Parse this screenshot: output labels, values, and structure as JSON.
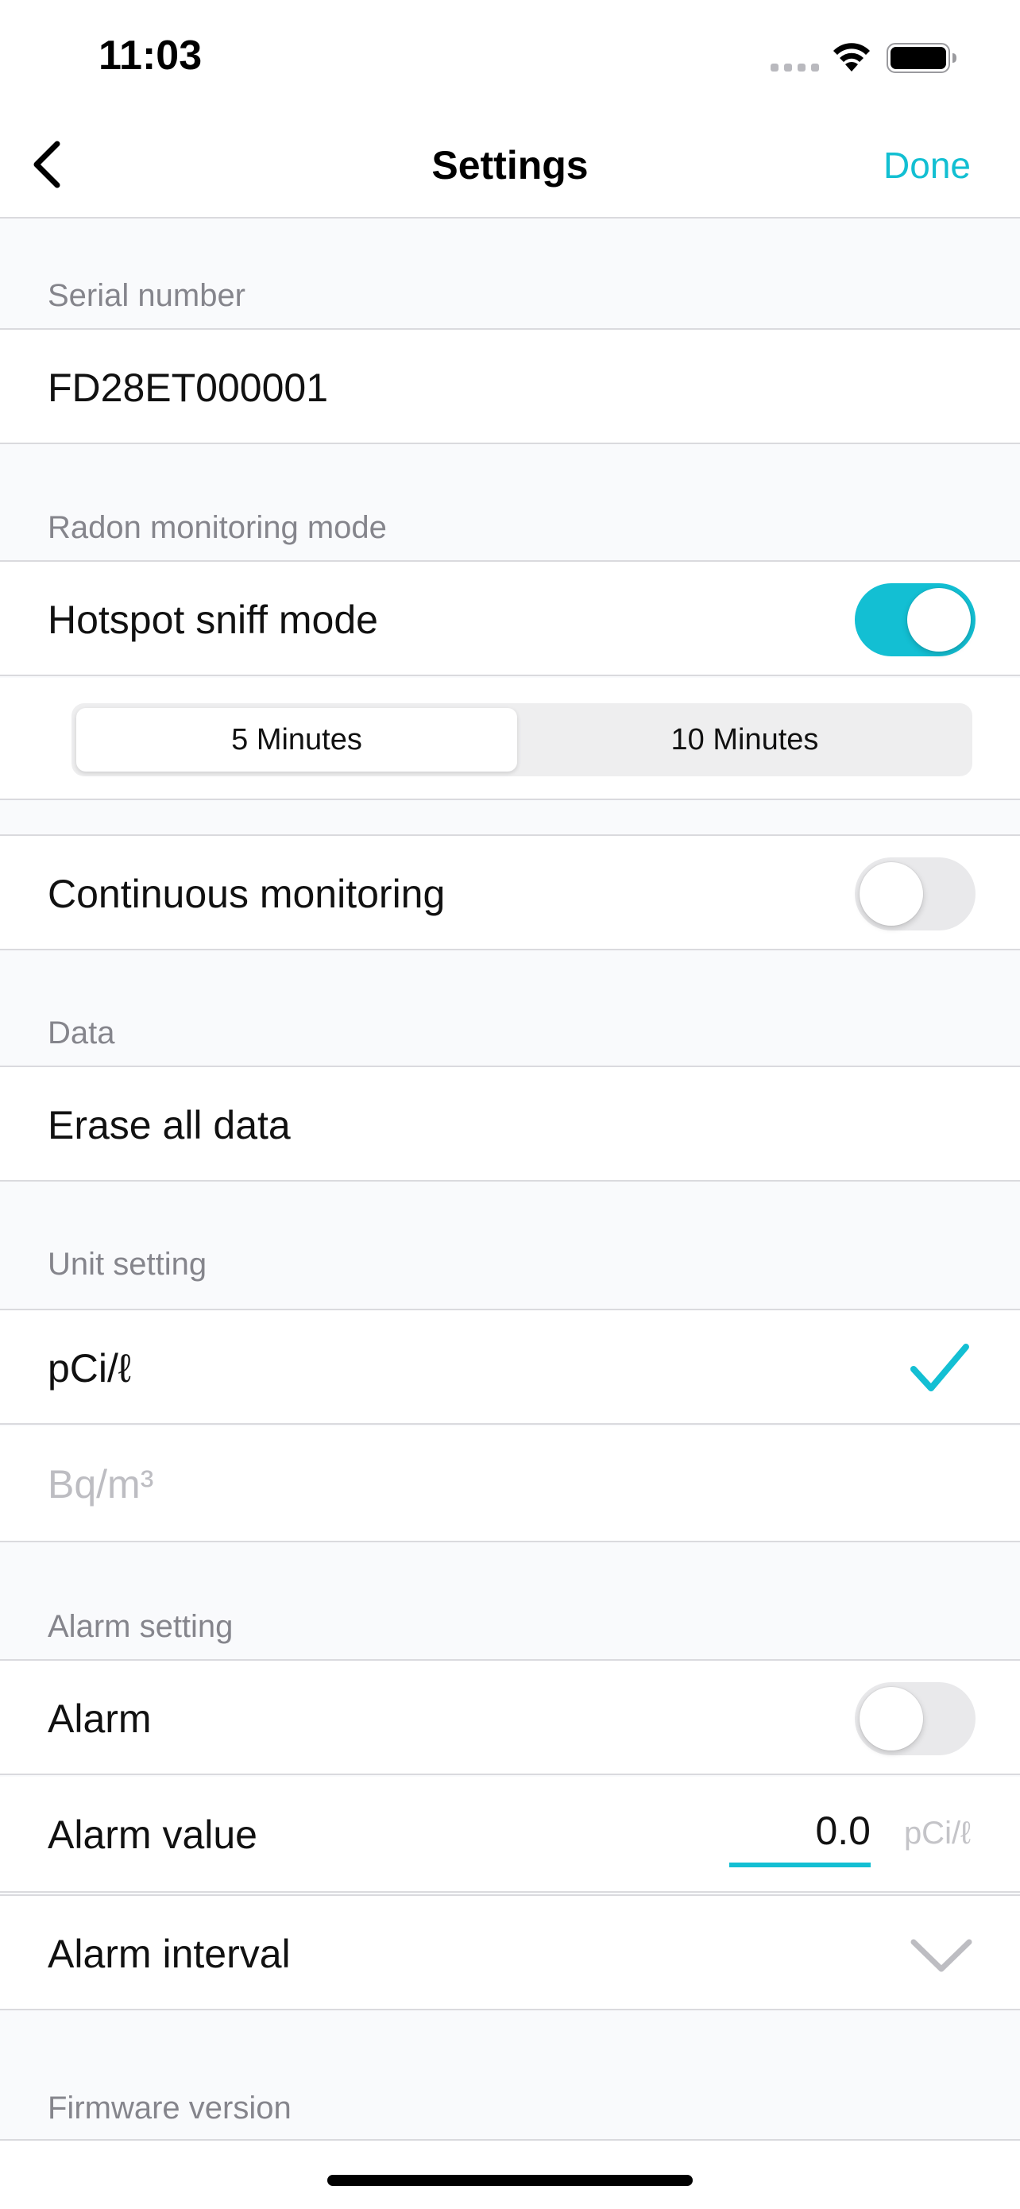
{
  "status_bar": {
    "time": "11:03"
  },
  "nav": {
    "title": "Settings",
    "done_label": "Done",
    "back_icon": "chevron-left-icon"
  },
  "accent_color": "#13BFD3",
  "sections": {
    "serial": {
      "header": "Serial number",
      "value": "FD28ET000001"
    },
    "radon_mode": {
      "header": "Radon monitoring mode",
      "hotspot_label": "Hotspot sniff mode",
      "hotspot_on": true,
      "segments": [
        "5 Minutes",
        "10 Minutes"
      ],
      "selected_segment": "5 Minutes",
      "continuous_label": "Continuous monitoring",
      "continuous_on": false
    },
    "data": {
      "header": "Data",
      "erase_label": "Erase all data"
    },
    "unit": {
      "header": "Unit setting",
      "options": [
        "pCi/ℓ",
        "Bq/m³"
      ],
      "selected": "pCi/ℓ"
    },
    "alarm": {
      "header": "Alarm setting",
      "alarm_label": "Alarm",
      "alarm_on": false,
      "value_label": "Alarm value",
      "value": "0.0",
      "value_unit": "pCi/ℓ",
      "interval_label": "Alarm interval"
    },
    "firmware": {
      "header": "Firmware version"
    }
  }
}
